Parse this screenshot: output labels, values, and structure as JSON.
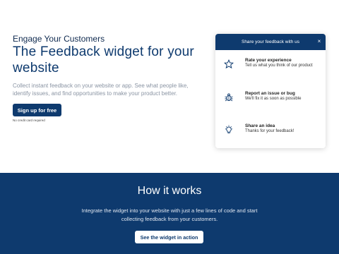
{
  "hero": {
    "eyebrow": "Engage Your Customers",
    "headline": "The Feedback widget for your website",
    "lede": "Collect instant feedback on your website or app. See what people like, identify issues, and find opportunities to make your product better.",
    "cta_label": "Sign up for free",
    "note": "No credit card required"
  },
  "widget": {
    "header": "Share your feedback with us",
    "close_glyph": "×",
    "items": [
      {
        "icon": "star-icon",
        "title": "Rate your experience",
        "desc": "Tell us what you think of our product"
      },
      {
        "icon": "bug-icon",
        "title": "Report an issue or bug",
        "desc": "We'll fix it as soon as possible"
      },
      {
        "icon": "lightbulb-icon",
        "title": "Share an idea",
        "desc": "Thanks for your feedback!"
      }
    ]
  },
  "how_it_works": {
    "title": "How it works",
    "description": "Integrate the widget into your website with just a few lines of code and start collecting feedback from your customers.",
    "button_label": "See the widget in action"
  },
  "colors": {
    "brand_navy": "#0e3a6e",
    "text_muted": "#8a94a3",
    "white": "#ffffff"
  }
}
